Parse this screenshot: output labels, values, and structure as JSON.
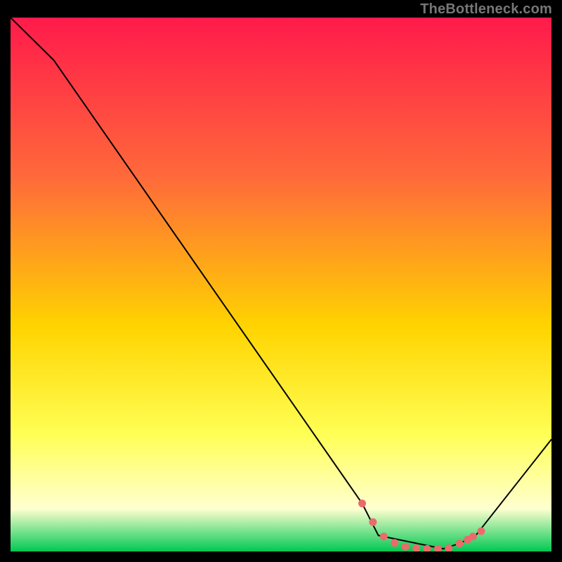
{
  "watermark": "TheBottleneck.com",
  "colors": {
    "line": "#000000",
    "marker_fill": "#ea6b6b",
    "marker_stroke": "#ea6b6b",
    "grad_top": "#ff1a4b",
    "grad_mid1": "#ff6a3a",
    "grad_mid2": "#ffd400",
    "grad_mid3": "#ffff55",
    "grad_mid4": "#ffffd0",
    "grad_bottom": "#00c853",
    "background": "#000000"
  },
  "chart_data": {
    "type": "line",
    "title": "",
    "xlabel": "",
    "ylabel": "",
    "xlim": [
      0,
      100
    ],
    "ylim": [
      0,
      100
    ],
    "series": [
      {
        "name": "curve",
        "x": [
          0,
          8,
          65,
          68,
          80,
          83,
          86,
          100
        ],
        "y": [
          100,
          92,
          9,
          3,
          0.5,
          1.5,
          3,
          21
        ]
      }
    ],
    "markers": {
      "name": "highlight",
      "x": [
        65,
        67,
        69,
        71,
        73,
        75,
        77,
        79,
        81,
        83,
        84.5,
        85.5,
        87
      ],
      "y": [
        9,
        5.5,
        2.8,
        1.6,
        0.9,
        0.6,
        0.5,
        0.5,
        0.6,
        1.5,
        2.2,
        2.8,
        3.8
      ],
      "radius": 5
    }
  }
}
